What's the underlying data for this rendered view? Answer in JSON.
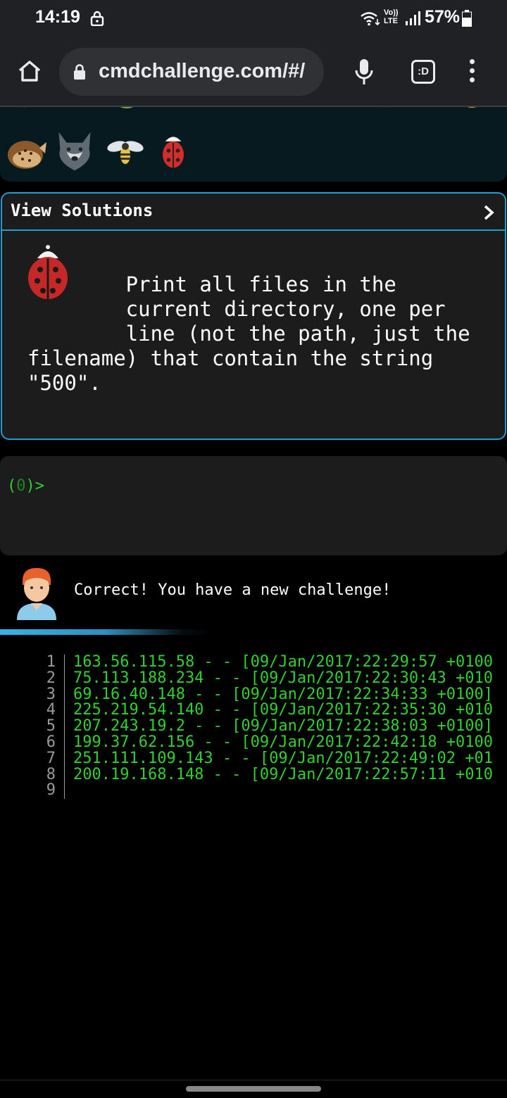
{
  "status_bar": {
    "time": "14:19",
    "network_label_1": "Vo))",
    "network_label_2": "LTE",
    "battery": "57%"
  },
  "browser": {
    "url": "cmdchallenge.com/#/",
    "tab_label": ":D"
  },
  "solutions_panel": {
    "title": "View Solutions",
    "challenge_text": "        Print all files in the\n        current directory, one per\n        line (not the path, just the\nfilename) that contain the string\n\"500\"."
  },
  "terminal": {
    "prompt_open": "(",
    "prompt_code": "0",
    "prompt_close": ")>"
  },
  "result": {
    "message": "Correct! You have a new challenge!",
    "progress": 0.6
  },
  "output": {
    "line_numbers": [
      "1",
      "2",
      "3",
      "4",
      "5",
      "6",
      "7",
      "8",
      "9"
    ],
    "lines": [
      "163.56.115.58 - - [09/Jan/2017:22:29:57 +0100",
      "75.113.188.234 - - [09/Jan/2017:22:30:43 +010",
      "69.16.40.148 - - [09/Jan/2017:22:34:33 +0100]",
      "225.219.54.140 - - [09/Jan/2017:22:35:30 +010",
      "207.243.19.2 - - [09/Jan/2017:22:38:03 +0100]",
      "199.37.62.156 - - [09/Jan/2017:22:42:18 +0100",
      "251.111.109.143 - - [09/Jan/2017:22:49:02 +01",
      "200.19.168.148 - - [09/Jan/2017:22:57:11 +010",
      ""
    ]
  },
  "colors": {
    "accent": "#1f9ed1",
    "terminal_green": "#2ed12e",
    "panel_bg": "#1c1c1c"
  },
  "icons": [
    "lock-icon",
    "wifi-icon",
    "signal-icon",
    "battery-icon",
    "home-icon",
    "mic-icon",
    "menu-icon",
    "chevron-right-icon",
    "ladybug-icon",
    "hedgehog-icon",
    "wolf-icon",
    "bee-icon",
    "person-avatar-icon"
  ]
}
